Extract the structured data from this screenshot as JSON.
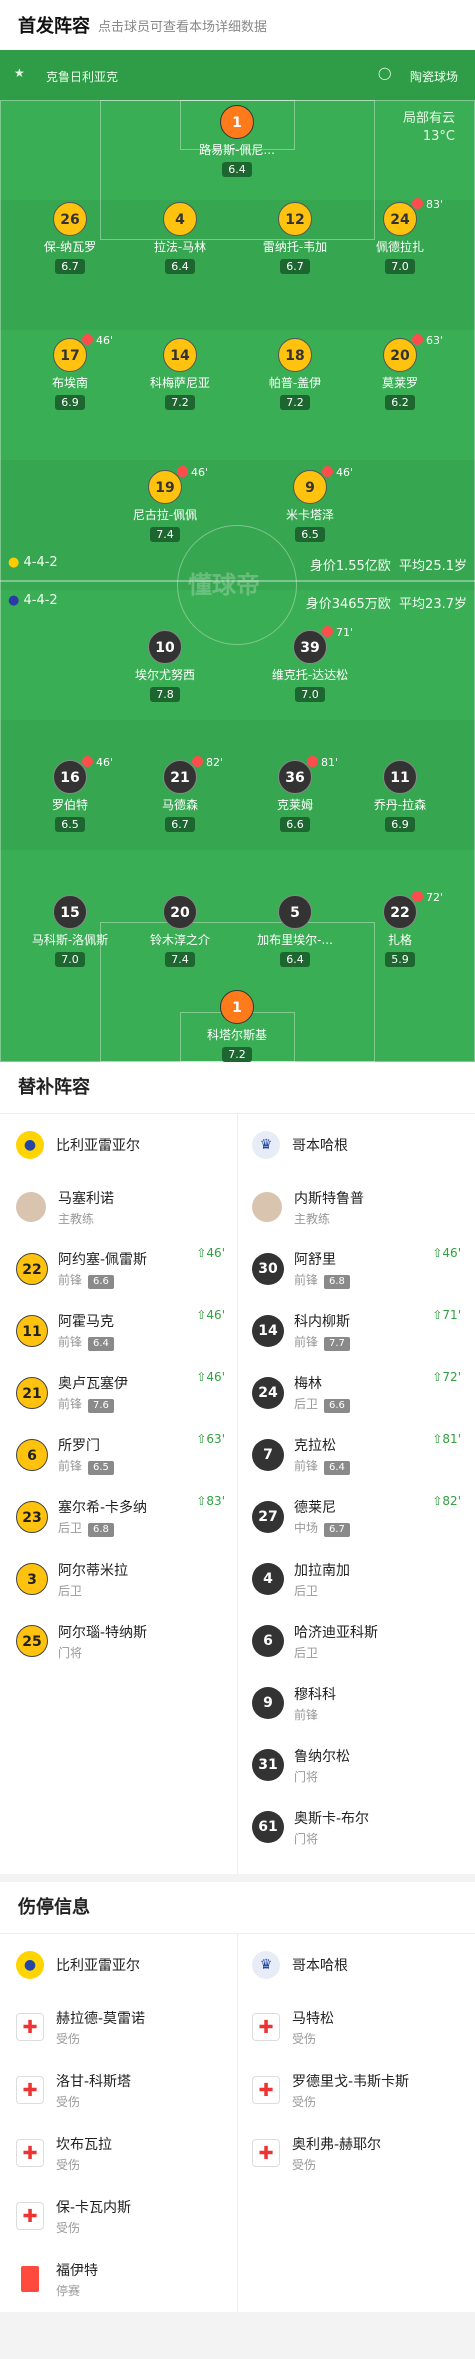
{
  "header": {
    "title": "首发阵容",
    "subtitle": "点击球员可查看本场详细数据"
  },
  "pitch": {
    "home_team": "克鲁日利亚克",
    "away_team": "陶瓷球场",
    "weather": "局部有云",
    "temperature": "13°C",
    "home_formation": "4-4-2",
    "home_value": "身价1.55亿欧",
    "home_age": "平均25.1岁",
    "away_formation": "4-4-2",
    "away_value": "身价3465万欧",
    "away_age": "平均23.7岁",
    "watermark": "懂球帝",
    "players": [
      {
        "no": "1",
        "name": "路易斯-佩尼...",
        "rating": "6.4",
        "color": "o"
      },
      {
        "no": "26",
        "name": "保-纳瓦罗",
        "rating": "6.7",
        "color": "y"
      },
      {
        "no": "4",
        "name": "拉法-马林",
        "rating": "6.4",
        "color": "y"
      },
      {
        "no": "12",
        "name": "雷纳托-韦加",
        "rating": "6.7",
        "color": "y"
      },
      {
        "no": "24",
        "name": "佩德拉扎",
        "rating": "7.0",
        "color": "y",
        "sub": "83'"
      },
      {
        "no": "17",
        "name": "布埃南",
        "rating": "6.9",
        "color": "y",
        "sub": "46'"
      },
      {
        "no": "14",
        "name": "科梅萨尼亚",
        "rating": "7.2",
        "color": "y"
      },
      {
        "no": "18",
        "name": "帕普-盖伊",
        "rating": "7.2",
        "color": "y"
      },
      {
        "no": "20",
        "name": "莫莱罗",
        "rating": "6.2",
        "color": "y",
        "sub": "63'"
      },
      {
        "no": "19",
        "name": "尼古拉-佩佩",
        "rating": "7.4",
        "color": "y",
        "sub": "46'"
      },
      {
        "no": "9",
        "name": "米卡塔泽",
        "rating": "6.5",
        "color": "y",
        "sub": "46'"
      },
      {
        "no": "10",
        "name": "埃尔尤努西",
        "rating": "7.8",
        "color": "d"
      },
      {
        "no": "39",
        "name": "维克托-达达松",
        "rating": "7.0",
        "color": "d",
        "sub": "71'"
      },
      {
        "no": "16",
        "name": "罗伯特",
        "rating": "6.5",
        "color": "d",
        "sub": "46'"
      },
      {
        "no": "21",
        "name": "马德森",
        "rating": "6.7",
        "color": "d",
        "sub": "82'"
      },
      {
        "no": "36",
        "name": "克莱姆",
        "rating": "6.6",
        "color": "d",
        "sub": "81'"
      },
      {
        "no": "11",
        "name": "乔丹-拉森",
        "rating": "6.9",
        "color": "d"
      },
      {
        "no": "15",
        "name": "马科斯-洛佩斯",
        "rating": "7.0",
        "color": "d"
      },
      {
        "no": "20",
        "name": "铃木淳之介",
        "rating": "7.4",
        "color": "d"
      },
      {
        "no": "5",
        "name": "加布里埃尔-...",
        "rating": "6.4",
        "color": "d"
      },
      {
        "no": "22",
        "name": "扎格",
        "rating": "5.9",
        "color": "d",
        "sub": "72'"
      },
      {
        "no": "1",
        "name": "科塔尔斯基",
        "rating": "7.2",
        "color": "o"
      }
    ]
  },
  "subs": {
    "title": "替补阵容",
    "home_team": "比利亚雷亚尔",
    "away_team": "哥本哈根",
    "home_coach": "马塞利诺",
    "away_coach": "内斯特鲁普",
    "coach_label": "主教练",
    "home": [
      {
        "no": "22",
        "name": "阿约塞-佩雷斯",
        "pos": "前锋",
        "rating": "6.6",
        "evt": "46'"
      },
      {
        "no": "11",
        "name": "阿霍马克",
        "pos": "前锋",
        "rating": "6.4",
        "evt": "46'"
      },
      {
        "no": "21",
        "name": "奥卢瓦塞伊",
        "pos": "前锋",
        "rating": "7.6",
        "evt": "46'"
      },
      {
        "no": "6",
        "name": "所罗门",
        "pos": "前锋",
        "rating": "6.5",
        "evt": "63'"
      },
      {
        "no": "23",
        "name": "塞尔希-卡多纳",
        "pos": "后卫",
        "rating": "6.8",
        "evt": "83'"
      },
      {
        "no": "3",
        "name": "阿尔蒂米拉",
        "pos": "后卫",
        "rating": "",
        "evt": ""
      },
      {
        "no": "25",
        "name": "阿尔瑙-特纳斯",
        "pos": "门将",
        "rating": "",
        "evt": ""
      }
    ],
    "away": [
      {
        "no": "30",
        "name": "阿舒里",
        "pos": "前锋",
        "rating": "6.8",
        "evt": "46'"
      },
      {
        "no": "14",
        "name": "科内柳斯",
        "pos": "前锋",
        "rating": "7.7",
        "evt": "71'"
      },
      {
        "no": "24",
        "name": "梅林",
        "pos": "后卫",
        "rating": "6.6",
        "evt": "72'"
      },
      {
        "no": "7",
        "name": "克拉松",
        "pos": "前锋",
        "rating": "6.4",
        "evt": "81'"
      },
      {
        "no": "27",
        "name": "德莱尼",
        "pos": "中场",
        "rating": "6.7",
        "evt": "82'"
      },
      {
        "no": "4",
        "name": "加拉南加",
        "pos": "后卫",
        "rating": "",
        "evt": ""
      },
      {
        "no": "6",
        "name": "哈济迪亚科斯",
        "pos": "后卫",
        "rating": "",
        "evt": ""
      },
      {
        "no": "9",
        "name": "穆科科",
        "pos": "前锋",
        "rating": "",
        "evt": ""
      },
      {
        "no": "31",
        "name": "鲁纳尔松",
        "pos": "门将",
        "rating": "",
        "evt": ""
      },
      {
        "no": "61",
        "name": "奥斯卡-布尔",
        "pos": "门将",
        "rating": "",
        "evt": ""
      }
    ]
  },
  "injuries": {
    "title": "伤停信息",
    "home_team": "比利亚雷亚尔",
    "away_team": "哥本哈根",
    "home": [
      {
        "name": "赫拉德-莫雷诺",
        "status": "受伤"
      },
      {
        "name": "洛甘-科斯塔",
        "status": "受伤"
      },
      {
        "name": "坎布瓦拉",
        "status": "受伤"
      },
      {
        "name": "保-卡瓦内斯",
        "status": "受伤"
      },
      {
        "name": "福伊特",
        "status": "停赛"
      }
    ],
    "away": [
      {
        "name": "马特松",
        "status": "受伤"
      },
      {
        "name": "罗德里戈-韦斯卡斯",
        "status": "受伤"
      },
      {
        "name": "奥利弗-赫耶尔",
        "status": "受伤"
      }
    ]
  }
}
